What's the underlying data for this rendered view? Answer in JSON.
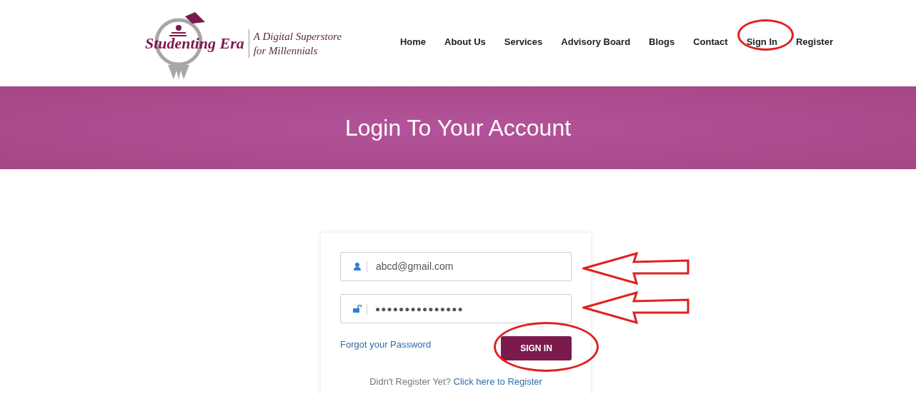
{
  "logo": {
    "name": "Studenting Era",
    "tagline": [
      "A Digital Superstore",
      "for Millennials"
    ]
  },
  "nav": [
    {
      "label": "Home"
    },
    {
      "label": "About Us"
    },
    {
      "label": "Services"
    },
    {
      "label": "Advisory Board"
    },
    {
      "label": "Blogs"
    },
    {
      "label": "Contact"
    },
    {
      "label": "Sign In"
    },
    {
      "label": "Register"
    }
  ],
  "banner": {
    "title": "Login To Your Account"
  },
  "form": {
    "email": {
      "value": "abcd@gmail.com"
    },
    "password": {
      "value": "●●●●●●●●●●●●●●●"
    },
    "forgot_link": "Forgot your Password",
    "submit": "SIGN IN",
    "register_prompt": "Didn't Register Yet?",
    "register_link": "Click here to Register"
  }
}
